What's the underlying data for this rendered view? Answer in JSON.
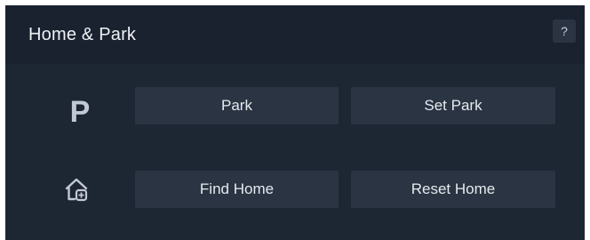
{
  "panel": {
    "title": "Home & Park",
    "help_label": "?"
  },
  "park_row": {
    "icon": "P",
    "icon_name": "park-icon",
    "buttons": [
      "Park",
      "Set Park"
    ]
  },
  "home_row": {
    "icon_name": "home-icon",
    "buttons": [
      "Find Home",
      "Reset Home"
    ]
  },
  "colors": {
    "panel_background": "#1d2633",
    "button_background": "#2a3443",
    "text": "#e6eaef",
    "icon": "#c2c9d4"
  }
}
